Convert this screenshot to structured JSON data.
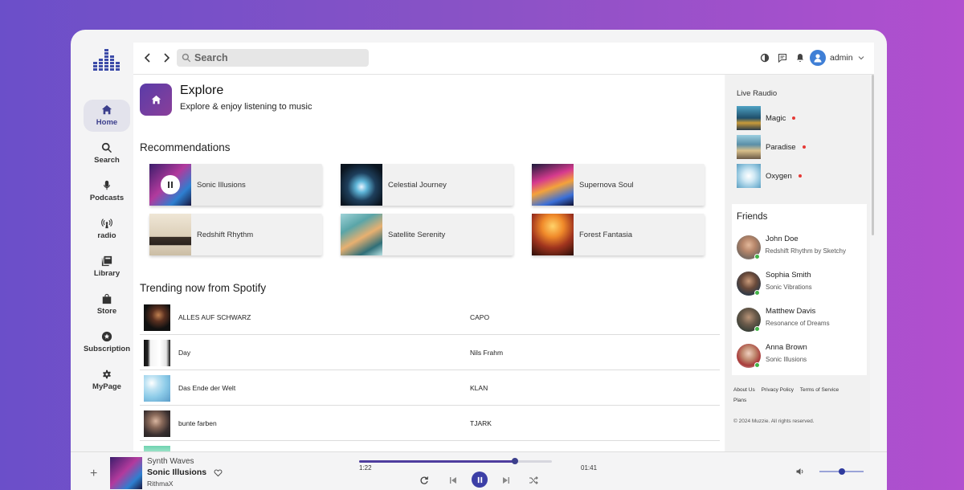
{
  "sidebar": {
    "items": [
      {
        "label": "Home",
        "icon": "home-icon",
        "active": true
      },
      {
        "label": "Search",
        "icon": "search-icon"
      },
      {
        "label": "Podcasts",
        "icon": "microphone-icon"
      },
      {
        "label": "radio",
        "icon": "radio-icon"
      },
      {
        "label": "Library",
        "icon": "library-icon"
      },
      {
        "label": "Store",
        "icon": "bag-icon"
      },
      {
        "label": "Subscription",
        "icon": "star-badge-icon"
      },
      {
        "label": "MyPage",
        "icon": "gear-icon"
      }
    ]
  },
  "topbar": {
    "search_placeholder": "Search",
    "username": "admin"
  },
  "explore": {
    "title": "Explore",
    "subtitle": "Explore & enjoy listening to music"
  },
  "recommendations": {
    "title": "Recommendations",
    "items": [
      {
        "name": "Sonic Illusions",
        "playing": true
      },
      {
        "name": "Celestial Journey"
      },
      {
        "name": "Supernova Soul"
      },
      {
        "name": "Redshift Rhythm"
      },
      {
        "name": "Satellite Serenity"
      },
      {
        "name": "Forest Fantasia"
      }
    ]
  },
  "trending": {
    "title": "Trending now from Spotify",
    "rows": [
      {
        "title": "ALLES AUF SCHWARZ",
        "artist": "CAPO"
      },
      {
        "title": "Day",
        "artist": "Nils Frahm"
      },
      {
        "title": "Das Ende der Welt",
        "artist": "KLAN"
      },
      {
        "title": "bunte farben",
        "artist": "TJARK"
      }
    ]
  },
  "live_radio": {
    "title": "Live Raudio",
    "stations": [
      {
        "name": "Magic"
      },
      {
        "name": "Paradise"
      },
      {
        "name": "Oxygen"
      }
    ]
  },
  "friends": {
    "title": "Friends",
    "list": [
      {
        "name": "John Doe",
        "song": "Redshift Rhythm by Sketchy"
      },
      {
        "name": "Sophia Smith",
        "song": "Sonic Vibrations"
      },
      {
        "name": "Matthew Davis",
        "song": "Resonance of Dreams"
      },
      {
        "name": "Anna Brown",
        "song": "Sonic Illusions"
      }
    ]
  },
  "footer": {
    "links": [
      "About Us",
      "Privacy Policy",
      "Terms of Service",
      "Plans"
    ],
    "copyright": "© 2024 Muzzie. All rights reserved."
  },
  "player": {
    "playlist": "Synth Waves",
    "title": "Sonic Illusions",
    "artist": "RithmaX",
    "elapsed": "1:22",
    "duration": "01:41",
    "progress": 0.81,
    "volume": 0.5
  },
  "colors": {
    "accent": "#3c3f8c",
    "live_dot": "#e53935",
    "online": "#43b347"
  }
}
